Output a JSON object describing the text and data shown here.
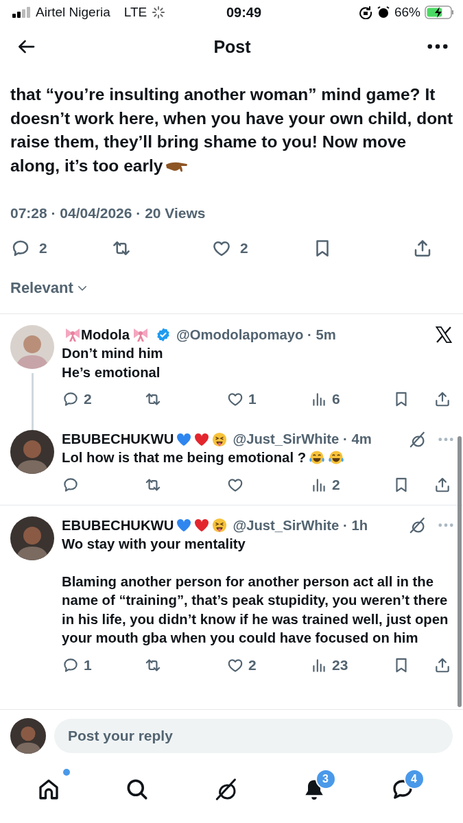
{
  "status_bar": {
    "carrier": "Airtel Nigeria",
    "network": "LTE",
    "time": "09:49",
    "battery": "66%"
  },
  "header": {
    "title": "Post"
  },
  "post": {
    "text": "that “you’re insulting another woman” mind game? It doesn’t work here, when you have your own child, dont raise them, they’ll bring shame to you! Now move along, it’s too early",
    "text_emoji": [
      {
        "kind": "palm-down-hand"
      }
    ],
    "meta": "07:28 · 04/04/2026 · **20** Views",
    "actions": [
      {
        "kind": "reply",
        "count": "2"
      },
      {
        "kind": "repost"
      },
      {
        "kind": "like",
        "count": "2"
      },
      {
        "kind": "bookmark"
      },
      {
        "kind": "share"
      }
    ]
  },
  "sort": {
    "label": "Relevant"
  },
  "replies": [
    {
      "name_parts": [
        {
          "kind": "bow"
        },
        {
          "kind": "text",
          "text": "Modola"
        },
        {
          "kind": "bow"
        }
      ],
      "verified": true,
      "handle": "@Omodolapomayo · 5m",
      "corner": [
        {
          "kind": "x-logo"
        }
      ],
      "connected": true,
      "body": "Don’t mind him\nHe’s emotional",
      "actions": [
        {
          "kind": "reply",
          "count": "2"
        },
        {
          "kind": "repost"
        },
        {
          "kind": "like",
          "count": "1"
        },
        {
          "kind": "views",
          "count": "6"
        },
        {
          "kind": "bookmark"
        },
        {
          "kind": "share"
        }
      ]
    },
    {
      "name_parts": [
        {
          "kind": "text",
          "text": "EBUBECHUKWU"
        },
        {
          "kind": "blue-heart"
        },
        {
          "kind": "red-heart"
        },
        {
          "kind": "tongue-face"
        }
      ],
      "verified": false,
      "handle": "@Just_SirWhite · 4m",
      "corner": [
        {
          "kind": "grok"
        },
        {
          "kind": "more"
        }
      ],
      "connected": false,
      "body": "Lol how is that me being emotional ?",
      "body_emoji": [
        {
          "kind": "laugh-cry"
        },
        {
          "kind": "laugh-cry"
        }
      ],
      "actions": [
        {
          "kind": "reply"
        },
        {
          "kind": "repost"
        },
        {
          "kind": "like"
        },
        {
          "kind": "views",
          "count": "2"
        },
        {
          "kind": "bookmark"
        },
        {
          "kind": "share"
        }
      ]
    },
    {
      "name_parts": [
        {
          "kind": "text",
          "text": "EBUBECHUKWU"
        },
        {
          "kind": "blue-heart"
        },
        {
          "kind": "red-heart"
        },
        {
          "kind": "tongue-face"
        }
      ],
      "verified": false,
      "handle": "@Just_SirWhite · 1h",
      "corner": [
        {
          "kind": "grok"
        },
        {
          "kind": "more"
        }
      ],
      "connected": false,
      "body": "Wo stay with your mentality\n\nBlaming another person for another person act all in the name of “training”, that’s peak stupidity, you weren’t there in his life, you didn’t know if he was trained well, just open your mouth gba when you could have focused on him",
      "actions": [
        {
          "kind": "reply",
          "count": "1"
        },
        {
          "kind": "repost"
        },
        {
          "kind": "like",
          "count": "2"
        },
        {
          "kind": "views",
          "count": "23"
        },
        {
          "kind": "bookmark"
        },
        {
          "kind": "share"
        }
      ]
    }
  ],
  "reply_box": {
    "placeholder": "Post your reply"
  },
  "nav": [
    {
      "kind": "home",
      "dot": true
    },
    {
      "kind": "search"
    },
    {
      "kind": "grok"
    },
    {
      "kind": "notifications",
      "badge": "3"
    },
    {
      "kind": "messages",
      "badge": "4"
    }
  ]
}
